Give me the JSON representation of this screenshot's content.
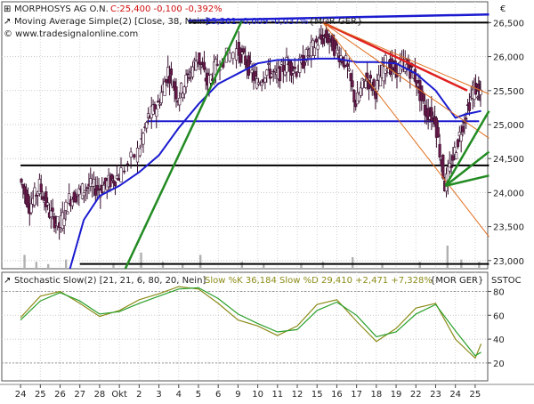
{
  "chart_data": [
    {
      "type": "line",
      "panel": "price",
      "header": {
        "line1_title": "MORPHOSYS AG O.N.",
        "line1_values": "C:25,400 -0,100 -0,392%",
        "line2_title": "Moving Average Simple(2) [Close, 38, Nein]",
        "line2_values": "25,201 -0,009 -0,037%",
        "line2_source": "{MOR GER}",
        "line3": "© www.tradesignalonline.com"
      },
      "currency": "€",
      "y_ticks": [
        "26,500",
        "26,000",
        "25,500",
        "25,000",
        "24,500",
        "24,000",
        "23,500",
        "23,000"
      ],
      "y_tick_values": [
        26.5,
        26.0,
        25.5,
        25.0,
        24.5,
        24.0,
        23.5,
        23.0
      ],
      "ylim": [
        22.88,
        26.78
      ],
      "grid": true,
      "x_ticks": [
        "24",
        "25",
        "26",
        "27",
        "28",
        "Okt",
        "2",
        "3",
        "4",
        "5",
        "6",
        "9",
        "10",
        "11",
        "12",
        "15",
        "16",
        "17",
        "18",
        "19",
        "22",
        "23",
        "24",
        "25"
      ],
      "close_path_sessions": [
        {
          "session": "24",
          "x": 0.0,
          "close": 24.2
        },
        {
          "session": "24",
          "x": 0.5,
          "close": 23.8
        },
        {
          "session": "25",
          "x": 1.0,
          "close": 24.1
        },
        {
          "session": "25",
          "x": 1.5,
          "close": 23.7
        },
        {
          "session": "26",
          "x": 2.0,
          "close": 23.5
        },
        {
          "session": "26",
          "x": 2.5,
          "close": 23.9
        },
        {
          "session": "27",
          "x": 3.0,
          "close": 24.0
        },
        {
          "session": "27",
          "x": 3.5,
          "close": 24.1
        },
        {
          "session": "28",
          "x": 4.0,
          "close": 24.05
        },
        {
          "session": "28",
          "x": 4.5,
          "close": 24.15
        },
        {
          "session": "Okt",
          "x": 5.0,
          "close": 24.25
        },
        {
          "session": "2",
          "x": 6.0,
          "close": 24.6
        },
        {
          "session": "2",
          "x": 6.5,
          "close": 25.1
        },
        {
          "session": "3",
          "x": 7.0,
          "close": 25.3
        },
        {
          "session": "3",
          "x": 7.5,
          "close": 25.8
        },
        {
          "session": "4",
          "x": 8.0,
          "close": 25.4
        },
        {
          "session": "4",
          "x": 8.5,
          "close": 25.7
        },
        {
          "session": "5",
          "x": 9.0,
          "close": 26.0
        },
        {
          "session": "5",
          "x": 9.5,
          "close": 25.6
        },
        {
          "session": "6",
          "x": 10.0,
          "close": 25.9
        },
        {
          "session": "9",
          "x": 11.0,
          "close": 26.1
        },
        {
          "session": "9",
          "x": 11.5,
          "close": 25.9
        },
        {
          "session": "10",
          "x": 12.0,
          "close": 25.6
        },
        {
          "session": "10",
          "x": 12.5,
          "close": 25.8
        },
        {
          "session": "11",
          "x": 13.0,
          "close": 25.7
        },
        {
          "session": "11",
          "x": 13.5,
          "close": 25.9
        },
        {
          "session": "12",
          "x": 14.0,
          "close": 25.8
        },
        {
          "session": "12",
          "x": 14.5,
          "close": 26.0
        },
        {
          "session": "15",
          "x": 15.0,
          "close": 26.2
        },
        {
          "session": "15",
          "x": 15.5,
          "close": 26.3
        },
        {
          "session": "16",
          "x": 16.0,
          "close": 26.1
        },
        {
          "session": "16",
          "x": 16.5,
          "close": 25.9
        },
        {
          "session": "17",
          "x": 17.0,
          "close": 25.3
        },
        {
          "session": "17",
          "x": 17.5,
          "close": 25.7
        },
        {
          "session": "18",
          "x": 18.0,
          "close": 25.5
        },
        {
          "session": "18",
          "x": 18.5,
          "close": 25.9
        },
        {
          "session": "19",
          "x": 19.0,
          "close": 25.8
        },
        {
          "session": "19",
          "x": 19.5,
          "close": 25.9
        },
        {
          "session": "22",
          "x": 20.0,
          "close": 25.7
        },
        {
          "session": "22",
          "x": 20.5,
          "close": 25.2
        },
        {
          "session": "23",
          "x": 21.0,
          "close": 25.1
        },
        {
          "session": "23",
          "x": 21.5,
          "close": 24.1
        },
        {
          "session": "24",
          "x": 22.0,
          "close": 24.6
        },
        {
          "session": "24",
          "x": 22.5,
          "close": 25.1
        },
        {
          "session": "25",
          "x": 23.0,
          "close": 25.55
        },
        {
          "session": "25",
          "x": 23.3,
          "close": 25.4
        }
      ],
      "moving_average": [
        {
          "x": 2.5,
          "y": 22.88
        },
        {
          "x": 3.2,
          "y": 23.6
        },
        {
          "x": 4.0,
          "y": 23.95
        },
        {
          "x": 5.0,
          "y": 24.1
        },
        {
          "x": 6.0,
          "y": 24.3
        },
        {
          "x": 7.0,
          "y": 24.55
        },
        {
          "x": 8.0,
          "y": 24.95
        },
        {
          "x": 9.0,
          "y": 25.3
        },
        {
          "x": 10.0,
          "y": 25.6
        },
        {
          "x": 11.0,
          "y": 25.75
        },
        {
          "x": 12.0,
          "y": 25.9
        },
        {
          "x": 13.0,
          "y": 25.95
        },
        {
          "x": 14.0,
          "y": 25.95
        },
        {
          "x": 15.0,
          "y": 25.97
        },
        {
          "x": 16.0,
          "y": 25.97
        },
        {
          "x": 17.0,
          "y": 25.92
        },
        {
          "x": 18.0,
          "y": 25.92
        },
        {
          "x": 19.0,
          "y": 25.9
        },
        {
          "x": 20.0,
          "y": 25.75
        },
        {
          "x": 21.0,
          "y": 25.5
        },
        {
          "x": 22.0,
          "y": 25.1
        },
        {
          "x": 22.5,
          "y": 25.15
        },
        {
          "x": 23.3,
          "y": 25.2
        }
      ],
      "horizontal_lines": [
        {
          "color": "#000000",
          "y": 26.5,
          "x_from": 8.5,
          "x_to": 23.7
        },
        {
          "color": "#1a1ad0",
          "y": 25.05,
          "x_from": 6.4,
          "x_to": 23.2
        },
        {
          "color": "#000000",
          "y": 24.4,
          "x_from": 0.0,
          "x_to": 23.7
        },
        {
          "color": "#000000",
          "y": 22.95,
          "x_from": 3.0,
          "x_to": 23.7
        }
      ],
      "trend_lines": [
        {
          "color": "#1a1ad0",
          "from": [
            8.5,
            26.53
          ],
          "to": [
            23.7,
            26.62
          ]
        },
        {
          "color": "#228b22",
          "from": [
            5.3,
            22.88
          ],
          "to": [
            11.2,
            26.53
          ]
        },
        {
          "color": "#e02020",
          "from": [
            15.3,
            26.5
          ],
          "to": [
            22.6,
            25.5
          ]
        },
        {
          "color": "#e07020",
          "from": [
            15.3,
            26.5
          ],
          "to": [
            23.7,
            25.45
          ]
        },
        {
          "color": "#e07020",
          "from": [
            15.3,
            26.5
          ],
          "to": [
            23.7,
            24.8
          ]
        },
        {
          "color": "#e07020",
          "from": [
            15.3,
            26.5
          ],
          "to": [
            23.7,
            23.35
          ]
        },
        {
          "color": "#228b22",
          "from": [
            21.5,
            24.1
          ],
          "to": [
            23.7,
            25.2
          ]
        },
        {
          "color": "#228b22",
          "from": [
            21.5,
            24.1
          ],
          "to": [
            23.7,
            24.6
          ]
        },
        {
          "color": "#228b22",
          "from": [
            21.5,
            24.1
          ],
          "to": [
            23.7,
            24.25
          ]
        }
      ],
      "volume": [
        {
          "x": 0.2,
          "rel": 0.6
        },
        {
          "x": 0.8,
          "rel": 0.3
        },
        {
          "x": 1.4,
          "rel": 0.2
        },
        {
          "x": 2.3,
          "rel": 0.4
        },
        {
          "x": 4.7,
          "rel": 0.25
        },
        {
          "x": 6.1,
          "rel": 0.7
        },
        {
          "x": 7.2,
          "rel": 0.3
        },
        {
          "x": 8.2,
          "rel": 0.2
        },
        {
          "x": 9.1,
          "rel": 0.6
        },
        {
          "x": 11.2,
          "rel": 0.3
        },
        {
          "x": 12.3,
          "rel": 0.2
        },
        {
          "x": 14.2,
          "rel": 0.25
        },
        {
          "x": 15.3,
          "rel": 0.3
        },
        {
          "x": 16.8,
          "rel": 0.5
        },
        {
          "x": 18.3,
          "rel": 0.25
        },
        {
          "x": 20.2,
          "rel": 0.3
        },
        {
          "x": 21.6,
          "rel": 1.0
        },
        {
          "x": 22.3,
          "rel": 0.4
        },
        {
          "x": 23.2,
          "rel": 0.3
        }
      ]
    },
    {
      "type": "line",
      "panel": "stochastic",
      "header": {
        "title": "Stochastic Slow(2) [21, 21, 6, 80, 20, Nein]",
        "values": "Slow %K 36,184 Slow %D 29,410 +2,471 +7,328%",
        "source": "{MOR GER}"
      },
      "axis_label": "SSTOC",
      "y_ticks": [
        "80",
        "60",
        "40",
        "20"
      ],
      "y_tick_values": [
        80,
        60,
        40,
        20
      ],
      "ylim": [
        5,
        96
      ],
      "reference_levels": [
        80,
        20
      ],
      "series": [
        {
          "name": "Slow %K",
          "color": "#8c8c1a",
          "points": [
            [
              0,
              58
            ],
            [
              1,
              76
            ],
            [
              2,
              80
            ],
            [
              3,
              70
            ],
            [
              4,
              59
            ],
            [
              5,
              64
            ],
            [
              6,
              73
            ],
            [
              7,
              78
            ],
            [
              8,
              84
            ],
            [
              9,
              82
            ],
            [
              10,
              70
            ],
            [
              11,
              56
            ],
            [
              12,
              51
            ],
            [
              13,
              43
            ],
            [
              14,
              51
            ],
            [
              15,
              69
            ],
            [
              16,
              73
            ],
            [
              17,
              55
            ],
            [
              18,
              38
            ],
            [
              19,
              49
            ],
            [
              20,
              66
            ],
            [
              21,
              70
            ],
            [
              22,
              40
            ],
            [
              23,
              24
            ],
            [
              23.3,
              36
            ]
          ]
        },
        {
          "name": "Slow %D",
          "color": "#2aa02a",
          "points": [
            [
              0,
              56
            ],
            [
              1,
              72
            ],
            [
              2,
              79
            ],
            [
              3,
              72
            ],
            [
              4,
              61
            ],
            [
              5,
              63
            ],
            [
              6,
              70
            ],
            [
              7,
              76
            ],
            [
              8,
              82
            ],
            [
              9,
              83
            ],
            [
              10,
              74
            ],
            [
              11,
              61
            ],
            [
              12,
              53
            ],
            [
              13,
              46
            ],
            [
              14,
              48
            ],
            [
              15,
              64
            ],
            [
              16,
              71
            ],
            [
              17,
              60
            ],
            [
              18,
              42
            ],
            [
              19,
              46
            ],
            [
              20,
              61
            ],
            [
              21,
              69
            ],
            [
              22,
              47
            ],
            [
              23,
              26
            ],
            [
              23.3,
              29
            ]
          ]
        }
      ]
    }
  ],
  "ui": {
    "accent_price": "#1a1ad0",
    "candle_up": "#ffffff",
    "candle_down": "#6a1a4a"
  }
}
